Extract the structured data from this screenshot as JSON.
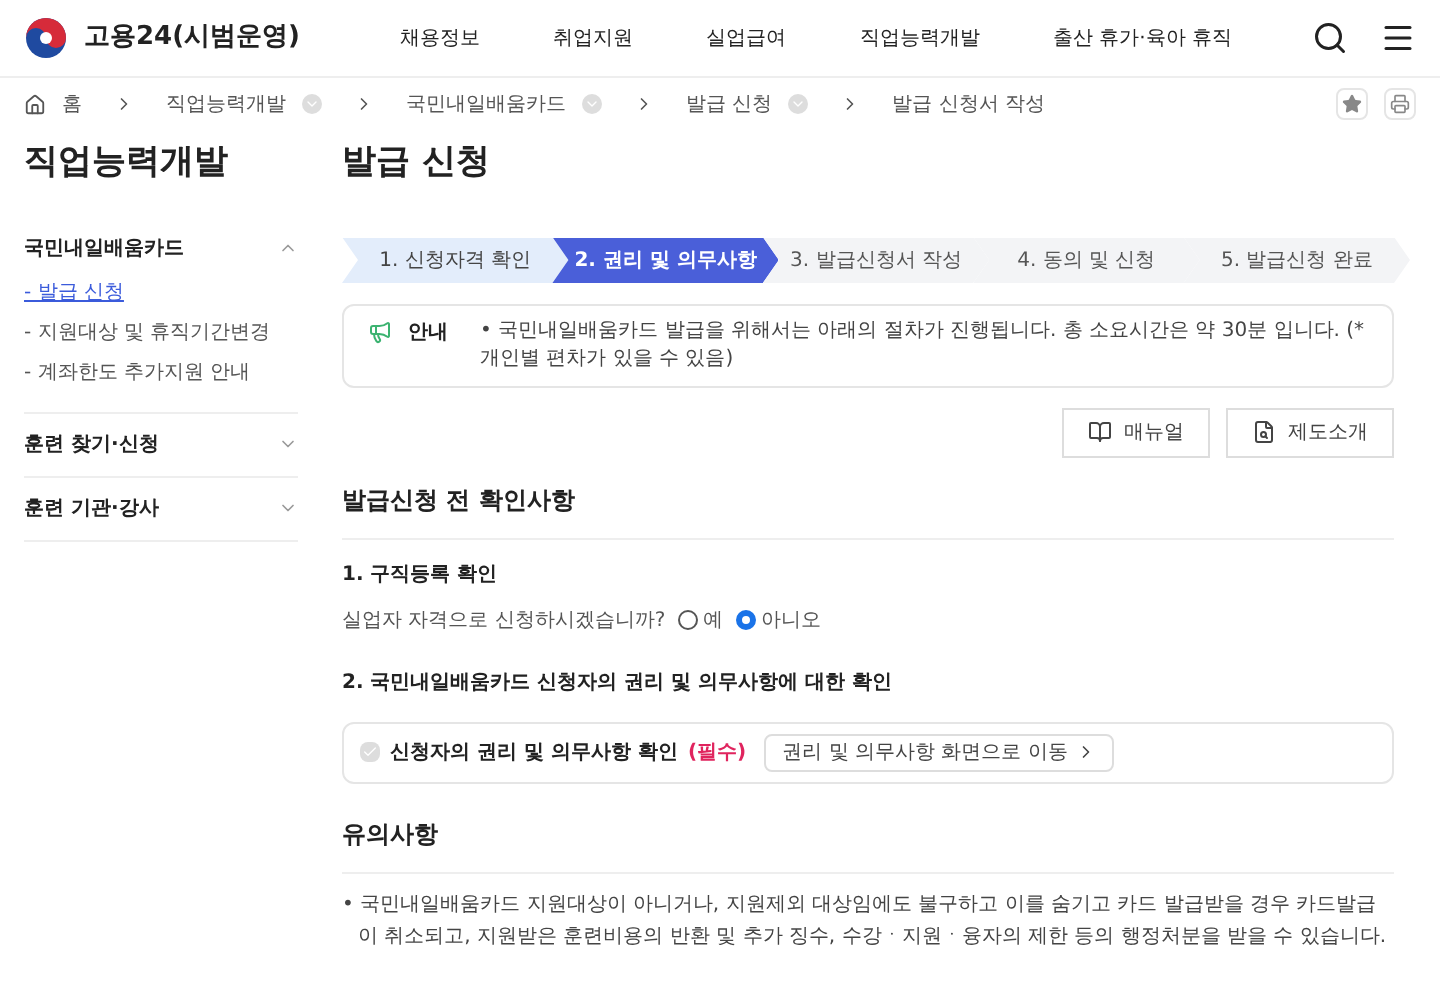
{
  "header": {
    "logo_text": "고용24(시범운영)",
    "nav": [
      {
        "label": "채용정보"
      },
      {
        "label": "취업지원"
      },
      {
        "label": "실업급여"
      },
      {
        "label": "직업능력개발"
      },
      {
        "label": "출산 휴가·육아 휴직"
      }
    ]
  },
  "breadcrumb": [
    {
      "label": "홈",
      "kind": "home"
    },
    {
      "label": "직업능력개발",
      "kind": "menu"
    },
    {
      "label": "국민내일배움카드",
      "kind": "menu"
    },
    {
      "label": "발급 신청",
      "kind": "menu"
    },
    {
      "label": "발급 신청서 작성",
      "kind": "current"
    }
  ],
  "sidebar": {
    "title": "직업능력개발",
    "groups": [
      {
        "label": "국민내일배움카드",
        "expanded": true,
        "children": [
          {
            "label": "- 발급 신청",
            "selected": true
          },
          {
            "label": "- 지원대상 및 휴직기간변경",
            "selected": false
          },
          {
            "label": "- 계좌한도 추가지원 안내",
            "selected": false
          }
        ]
      },
      {
        "label": "훈련 찾기·신청",
        "expanded": false
      },
      {
        "label": "훈련 기관·강사",
        "expanded": false
      }
    ]
  },
  "page_title": "발급 신청",
  "steps": [
    {
      "label": "1. 신청자격 확인",
      "done": true,
      "selected": false
    },
    {
      "label": "2. 권리 및 의무사항",
      "done": false,
      "selected": true
    },
    {
      "label": "3. 발급신청서 작성",
      "done": false,
      "selected": false
    },
    {
      "label": "4. 동의 및 신청",
      "done": false,
      "selected": false
    },
    {
      "label": "5. 발급신청 완료",
      "done": false,
      "selected": false
    }
  ],
  "notice": {
    "label": "안내",
    "text": "• 국민내일배움카드 발급을 위해서는 아래의 절차가 진행됩니다. 총 소요시간은 약 30분 입니다. (*개인별 편차가 있을 수 있음)"
  },
  "buttons": [
    {
      "label": "매뉴얼",
      "kind": "manual"
    },
    {
      "label": "제도소개",
      "kind": "intro"
    }
  ],
  "check_section": {
    "title": "발급신청 전 확인사항",
    "q1": {
      "title": "1. 구직등록 확인",
      "question": "실업자 자격으로 신청하시겠습니까?",
      "options": [
        {
          "label": "예",
          "selected": false
        },
        {
          "label": "아니오",
          "selected": true
        }
      ]
    },
    "q2": {
      "title": "2. 국민내일배움카드 신청자의 권리 및 의무사항에 대한 확인",
      "checkbox": {
        "label": "신청자의 권리 및 의무사항 확인",
        "required": "(필수)",
        "checked": true,
        "disabled": true
      },
      "link": "권리 및 의무사항 화면으로 이동"
    }
  },
  "caution": {
    "title": "유의사항",
    "items": [
      "• 국민내일배움카드 지원대상이 아니거나, 지원제외 대상임에도 불구하고 이를 숨기고 카드 발급받을 경우 카드발급이 취소되고, 지원받은 훈련비용의 반환 및 추가 징수, 수강ㆍ지원ㆍ융자의 제한 등의 행정처분을 받을 수 있습니다."
    ]
  }
}
